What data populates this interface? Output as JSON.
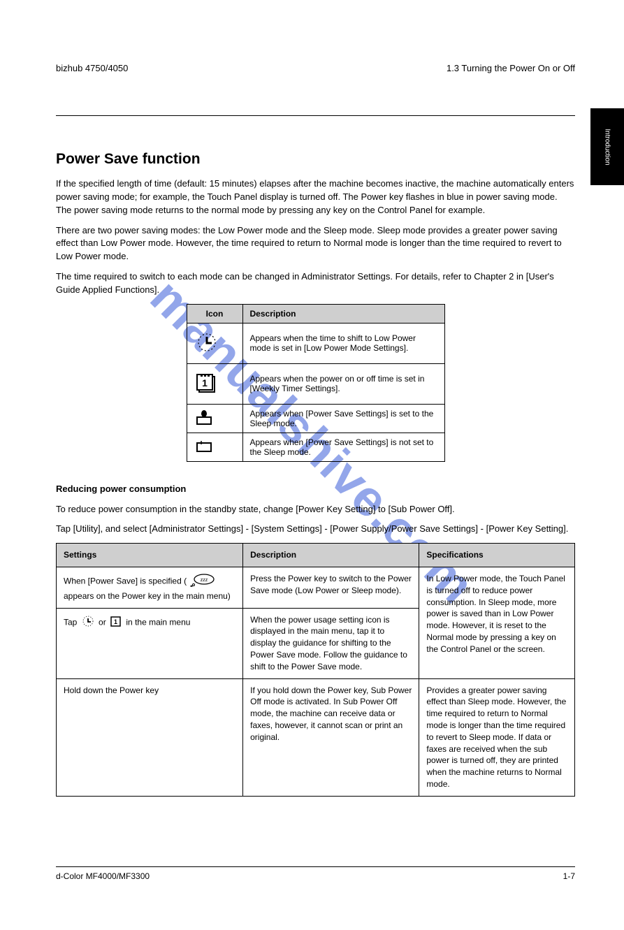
{
  "header": {
    "left": "bizhub 4750/4050",
    "right": "1.3 Turning the Power On or Off"
  },
  "sidetab": "Introduction",
  "section1": {
    "title": "Power Save function",
    "p1": "If the specified length of time (default: 15 minutes) elapses after the machine becomes inactive, the machine automatically enters power saving mode; for example, the Touch Panel display is turned off. The Power key flashes in blue in power saving mode. The power saving mode returns to the normal mode by pressing any key on the Control Panel for example.",
    "p2": "There are two power saving modes: the Low Power mode and the Sleep mode. Sleep mode provides a greater power saving effect than Low Power mode. However, the time required to return to Normal mode is longer than the time required to revert to Low Power mode.",
    "p3": "The time required to switch to each mode can be changed in Administrator Settings. For details, refer to Chapter 2 in [User's Guide Applied Functions].",
    "table_headers": {
      "icon": "Icon",
      "desc": "Description"
    },
    "rows": [
      {
        "icon_name": "clock-icon",
        "desc": "Appears when the time to shift to Low Power mode is set in [Low Power Mode Settings]."
      },
      {
        "icon_name": "calendar-icon",
        "desc": "Appears when the power on or off time is set in [Weekly Timer Settings]."
      },
      {
        "icon_name": "power-save-active-icon",
        "desc": "Appears when [Power Save Settings] is set to the Sleep mode."
      },
      {
        "icon_name": "power-save-inactive-icon",
        "desc": "Appears when [Power Save Settings] is not set to the Sleep mode."
      }
    ]
  },
  "section2": {
    "subtitle": "Reducing power consumption",
    "intro": "To reduce power consumption in the standby state, change [Power Key Setting] to [Sub Power Off].",
    "intro2": "Tap [Utility], and select [Administrator Settings] - [System Settings] - [Power Supply/Power Save Settings] - [Power Key Setting].",
    "headers": {
      "a": "Settings",
      "b": "Description",
      "c": "Specifications"
    },
    "rows": [
      {
        "a_prefix": "When [Power Save] is specified (",
        "a_note_icon": "zzz-bubble-icon",
        "a_suffix": " appears on the Power key in the main menu)",
        "b": "Press the Power key to switch to the Power Save mode (Low Power or Sleep mode).",
        "c": ""
      },
      {
        "a_prefix": "Tap ",
        "a_mid": " or ",
        "a_suffix": " in the main menu",
        "a_icon1": "clock-small-icon",
        "a_icon2": "calendar-small-icon",
        "b": "When the power usage setting icon is displayed in the main menu, tap it to display the guidance for shifting to the Power Save mode. Follow the guidance to shift to the Power Save mode.",
        "c": "In Low Power mode, the Touch Panel is turned off to reduce power consumption. In Sleep mode, more power is saved than in Low Power mode. However, it is reset to the Normal mode by pressing a key on the Control Panel or the screen."
      },
      {
        "a": "Hold down the Power key",
        "b": "If you hold down the Power key, Sub Power Off mode is activated. In Sub Power Off mode, the machine can receive data or faxes, however, it cannot scan or print an original.",
        "c": "Provides a greater power saving effect than Sleep mode. However, the time required to return to Normal mode is longer than the time required to revert to Sleep mode. If data or faxes are received when the sub power is turned off, they are printed when the machine returns to Normal mode."
      }
    ]
  },
  "footer": {
    "left": "d-Color MF4000/MF3300",
    "right": "1-7"
  },
  "watermark": "manualshive.com"
}
